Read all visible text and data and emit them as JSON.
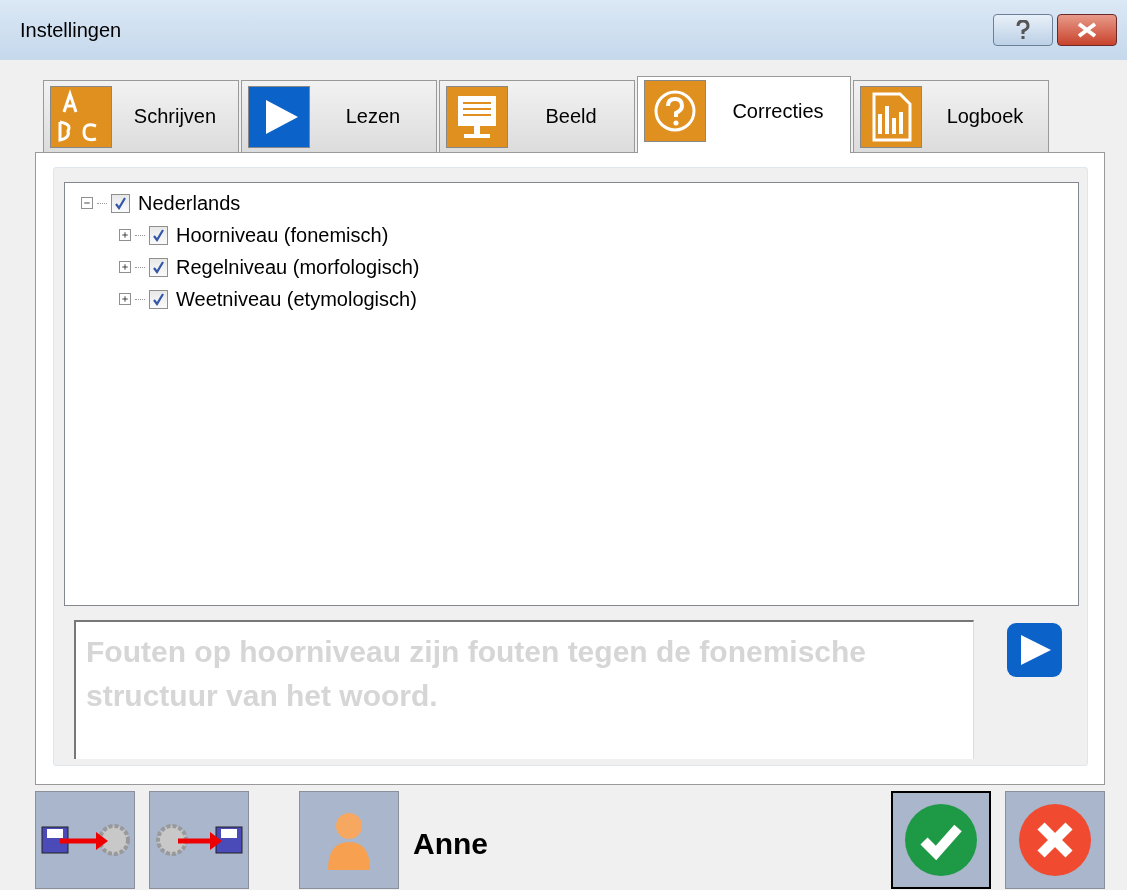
{
  "window": {
    "title": "Instellingen"
  },
  "tabs": [
    {
      "label": "Schrijven",
      "selected": false
    },
    {
      "label": "Lezen",
      "selected": false
    },
    {
      "label": "Beeld",
      "selected": false
    },
    {
      "label": "Correcties",
      "selected": true
    },
    {
      "label": "Logboek",
      "selected": false
    }
  ],
  "tree": [
    {
      "label": "Nederlands",
      "checked": true,
      "expanded": true,
      "children": [
        {
          "label": "Hoorniveau (fonemisch)",
          "checked": true,
          "expanded": false
        },
        {
          "label": "Regelniveau (morfologisch)",
          "checked": true,
          "expanded": false
        },
        {
          "label": "Weetniveau (etymologisch)",
          "checked": true,
          "expanded": false
        }
      ]
    }
  ],
  "description": {
    "text": "Fouten op hoorniveau zijn fouten tegen de fonemische structuur van het woord."
  },
  "footer": {
    "user_name": "Anne"
  }
}
